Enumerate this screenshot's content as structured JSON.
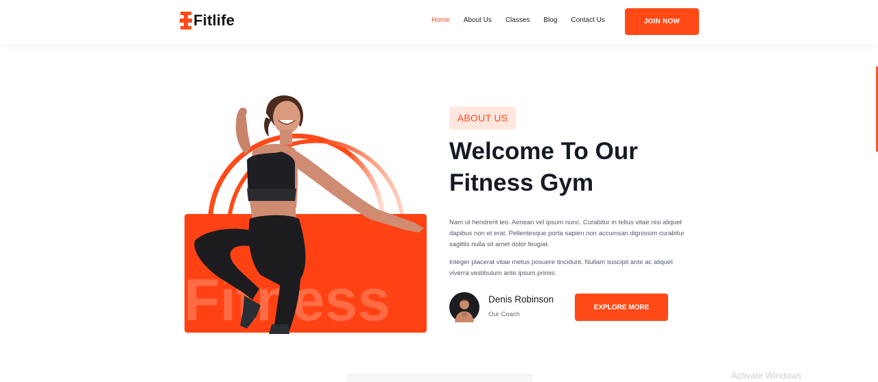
{
  "brand": {
    "name": "Fitlife",
    "icon": "dumbbell-icon",
    "accent": "#ff4a17"
  },
  "nav": {
    "items": [
      {
        "label": "Home",
        "active": true
      },
      {
        "label": "About Us",
        "active": false
      },
      {
        "label": "Classes",
        "active": false
      },
      {
        "label": "Blog",
        "active": false
      },
      {
        "label": "Contact Us",
        "active": false
      }
    ],
    "join_label": "JOIN NOW"
  },
  "hero": {
    "background_word": "Fitness",
    "image": "woman-jumping-photo"
  },
  "about": {
    "badge": "ABOUT US",
    "heading_line1": "Welcome To Our",
    "heading_line2": "Fitness Gym",
    "paragraph1": "Nam ut hendrerit leo. Aenean vel ipsum nunc. Curabitur in tellus vitae nisi aliquet dapibus non et erat. Pellentesque porta sapien non accumsan dignissim curabitur sagittis nulla sit amet dolor feugiat.",
    "paragraph2": "Integer placerat vitae metus posuere tincidunt. Nullam suscipit ante ac aliquet viverra vestibulum ante ipsum primis.",
    "coach_name": "Denis Robinson",
    "coach_role": "Our Coach",
    "explore_label": "EXPLORE MORE"
  },
  "system": {
    "watermark": "Activate Windows"
  }
}
